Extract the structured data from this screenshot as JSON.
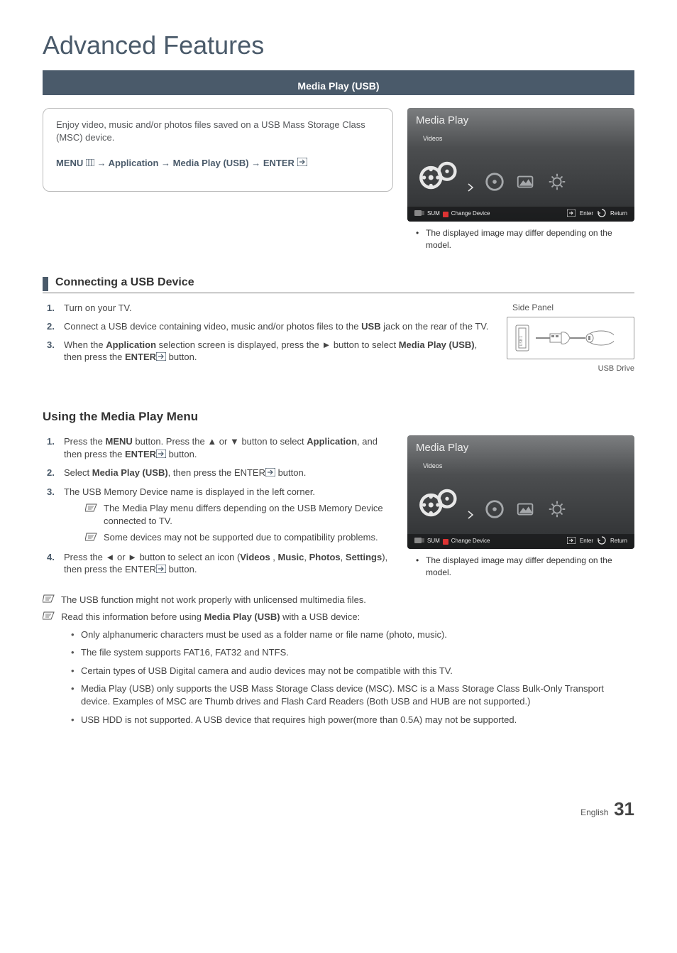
{
  "page_title": "Advanced Features",
  "section_banner": "Media Play (USB)",
  "intro": {
    "text": "Enjoy video, music and/or photos files saved on a USB Mass Storage Class (MSC) device.",
    "menu_prefix": "MENU",
    "menu_path_1": "Application",
    "menu_path_2": "Media Play (USB)",
    "menu_path_3": "ENTER"
  },
  "media_play_widget": {
    "title": "Media Play",
    "selected_label": "Videos",
    "footer_left_1": "SUM",
    "footer_left_2": "Change Device",
    "footer_key_a": "A",
    "footer_right_1": "Enter",
    "footer_right_2": "Return",
    "caption": "The displayed image may differ depending on the model."
  },
  "subhead_connect": "Connecting a USB Device",
  "connect_steps": [
    "Turn on your TV.",
    "Connect a USB device containing video, music and/or photos files to the USB jack on the rear of the TV.",
    "When the Application selection screen is displayed, press the ► button to select Media Play (USB), then press the ENTER button."
  ],
  "side_panel": {
    "label": "Side Panel",
    "usb_label": "USB Drive",
    "port_label": "USB 1"
  },
  "subhead_using": "Using the Media Play Menu",
  "using_steps": {
    "s1a": "Press the ",
    "s1b": " button. Press the ▲ or ▼ button to select ",
    "s1c": ", and then press the ",
    "s1d": " button.",
    "menu": "MENU",
    "application": "Application",
    "enter": "ENTER",
    "s2a": "Select ",
    "s2b": ", then press the ENTER",
    "s2c": " button.",
    "mediaplay": "Media Play (USB)",
    "s3": "The USB Memory Device name is displayed in the left corner.",
    "s3n1": "The Media Play menu differs depending on the USB Memory Device connected to TV.",
    "s3n2": "Some devices may not be supported due to compatibility problems.",
    "s4a": "Press the ◄ or ► button to select an icon (",
    "videos": "Videos",
    "music": "Music",
    "photos": "Photos",
    "settings": "Settings",
    "s4b": "), then press the ENTER",
    "s4c": " button."
  },
  "global_notes": {
    "n1": "The USB function might not work properly with unlicensed multimedia files.",
    "n2a": "Read this information before using ",
    "n2b": " with a USB device:",
    "mediaplay": "Media Play (USB)",
    "bullets": [
      "Only alphanumeric characters must be used as a folder name or file name (photo, music).",
      "The file system supports FAT16, FAT32 and NTFS.",
      "Certain types of USB Digital camera and audio devices may not be compatible with this TV.",
      "Media Play (USB) only supports the USB Mass Storage Class device (MSC). MSC is a Mass Storage Class Bulk-Only Transport device. Examples of MSC are Thumb drives and Flash Card Readers (Both USB and HUB are not supported.)",
      "USB HDD is not supported. A USB device that requires high power(more than 0.5A) may not be supported."
    ]
  },
  "footer": {
    "lang": "English",
    "page": "31"
  }
}
